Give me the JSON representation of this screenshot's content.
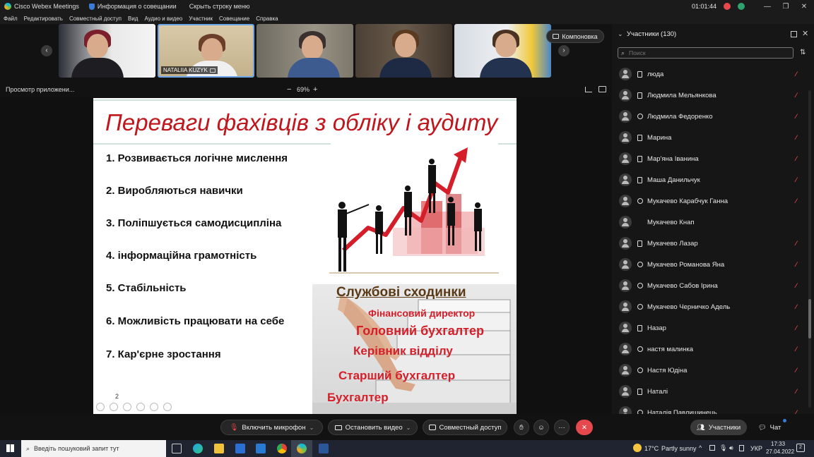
{
  "titlebar": {
    "app_name": "Cisco Webex Meetings",
    "meeting_info": "Информация о совещании",
    "hide_menu": "Скрыть строку меню",
    "timer": "01:01:44",
    "win_min": "—",
    "win_restore": "❐",
    "win_close": "✕"
  },
  "menubar": {
    "items": [
      "Файл",
      "Редактировать",
      "Совместный доступ",
      "Вид",
      "Аудио и видео",
      "Участник",
      "Совещание",
      "Справка"
    ]
  },
  "video": {
    "tiles": [
      {
        "name": ""
      },
      {
        "name": "NATALIIA KUZYK"
      },
      {
        "name": ""
      },
      {
        "name": ""
      },
      {
        "name": ""
      }
    ],
    "prev_arrow": "‹",
    "next_arrow": "›",
    "layout_label": "Компоновка"
  },
  "sharebar": {
    "label": "Просмотр приложени...",
    "zoom": "69%",
    "minus": "−",
    "plus": "+"
  },
  "slide": {
    "title": "Переваги фахівців з обліку і аудиту",
    "points": [
      "1.  Розвивається логічне мислення",
      "2.  Виробляються навички",
      "3.  Поліпшується самодисципліна",
      "4.   інформаційна грамотність",
      "5.  Стабільність",
      "6.  Можливість працювати на себе",
      "7.  Кар'єрне зростання"
    ],
    "steps_heading": "Службові сходинки",
    "steps": [
      "Фінансовий директор",
      "Головний бухгалтер",
      "Керівник  відділу",
      "Старший бухгалтер",
      "Бухгалтер"
    ],
    "page_number": "2"
  },
  "participants": {
    "header": "Участники (130)",
    "search_placeholder": "Поиск",
    "list": [
      {
        "name": "люда",
        "device": "phone",
        "muted": true
      },
      {
        "name": "Людмила Мельянкова",
        "device": "phone",
        "muted": true
      },
      {
        "name": "Людмила Федоренко",
        "device": "web",
        "muted": true
      },
      {
        "name": "Марина",
        "device": "phone",
        "muted": true
      },
      {
        "name": "Мар'яна Іванина",
        "device": "phone",
        "muted": true
      },
      {
        "name": "Маша Данильчук",
        "device": "phone",
        "muted": true
      },
      {
        "name": "Мукачево Карабчук Ганна",
        "device": "web",
        "muted": true
      },
      {
        "name": "Мукачево Кнап",
        "device": "",
        "muted": false
      },
      {
        "name": "Мукачево Лазар",
        "device": "phone",
        "muted": true
      },
      {
        "name": "Мукачево Романова Яна",
        "device": "web",
        "muted": true
      },
      {
        "name": "Мукачево Сабов Ірина",
        "device": "web",
        "muted": true
      },
      {
        "name": "Мукачево Черничко Адель",
        "device": "web",
        "muted": true
      },
      {
        "name": "Назар",
        "device": "phone",
        "muted": true
      },
      {
        "name": "настя малинка",
        "device": "web",
        "muted": true
      },
      {
        "name": "Настя Юдіна",
        "device": "web",
        "muted": true
      },
      {
        "name": "Наталі",
        "device": "phone",
        "muted": true
      },
      {
        "name": "Наталія Павлишинець",
        "device": "web",
        "muted": true
      }
    ]
  },
  "controls": {
    "mic": "Включить микрофон",
    "video": "Остановить видео",
    "share": "Совместный доступ",
    "more": "···",
    "end": "✕",
    "participants": "Участники",
    "chat": "Чат"
  },
  "taskbar": {
    "search_placeholder": "Введіть пошуковий запит тут",
    "weather_temp": "17°C",
    "weather_text": "Partly sunny",
    "lang": "УКР",
    "time": "17:33",
    "date": "27.04.2022",
    "notif_count": "2"
  },
  "colors": {
    "slide_red": "#c0161d",
    "end_call": "#e5484d",
    "accent_blue": "#3a7bd5"
  }
}
